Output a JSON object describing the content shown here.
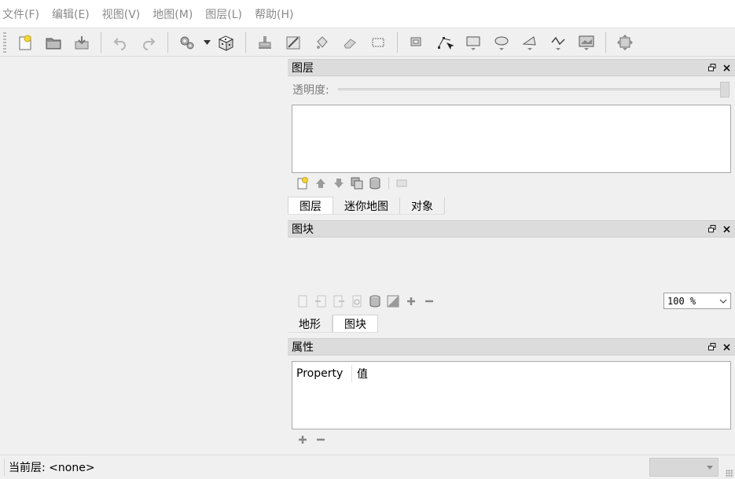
{
  "menu": [
    "文件(F)",
    "编辑(E)",
    "视图(V)",
    "地图(M)",
    "图层(L)",
    "帮助(H)"
  ],
  "toolbar": {
    "icons": [
      "new-map-icon",
      "open-icon",
      "save-icon",
      "undo-icon",
      "redo-icon",
      "commands-icon",
      "dropdown-arrow-icon",
      "random-dice-icon",
      "stamp-brush-icon",
      "bucket-fill-icon",
      "paint-icon",
      "eraser-icon",
      "rectangle-select-icon",
      "select-objects-icon",
      "edit-polygons-icon",
      "insert-rectangle-icon",
      "insert-ellipse-icon",
      "insert-polygon-icon",
      "insert-polyline-icon",
      "insert-tile-icon",
      "center-view-icon"
    ]
  },
  "layers_dock": {
    "title": "图层",
    "opacity_label": "透明度:",
    "opacity": 1.0,
    "buttons": [
      "add-layer-icon",
      "raise-layer-icon",
      "lower-layer-icon",
      "duplicate-layer-icon",
      "delete-layer-icon",
      "toggle-layer-icon"
    ],
    "tabs": [
      "图层",
      "迷你地图",
      "对象"
    ],
    "active_tab": 0
  },
  "tileset_dock": {
    "title": "图块",
    "buttons": [
      "new-tileset-icon",
      "import-tileset-icon",
      "export-tileset-icon",
      "tileset-properties-icon",
      "delete-tileset-icon",
      "edit-terrain-icon",
      "add-tiles-icon",
      "remove-tiles-icon"
    ],
    "zoom": "100 %",
    "tabs": [
      "地形",
      "图块"
    ],
    "active_tab": 1
  },
  "properties_dock": {
    "title": "属性",
    "col_property": "Property",
    "col_value": "值",
    "buttons": [
      "add-property-icon",
      "remove-property-icon"
    ]
  },
  "statusbar": {
    "current_layer": "当前层: <none>"
  }
}
